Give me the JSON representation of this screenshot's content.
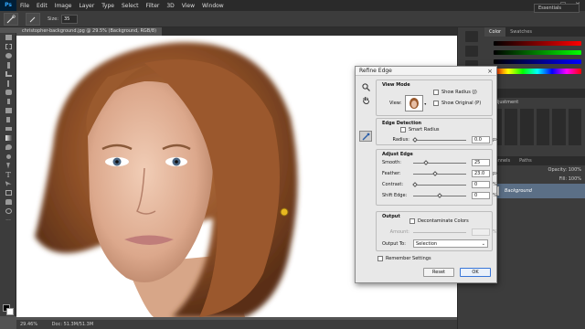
{
  "app": {
    "logo": "Ps"
  },
  "menubar": {
    "items": [
      "File",
      "Edit",
      "Image",
      "Layer",
      "Type",
      "Select",
      "Filter",
      "3D",
      "View",
      "Window"
    ]
  },
  "options": {
    "size_label": "Size:",
    "size_value": "35"
  },
  "workspace": {
    "value": "Essentials"
  },
  "document": {
    "tab_title": "christopher-background.jpg @ 29.5% (Background, RGB/8)",
    "zoom": "29.46%",
    "doc_info": "Doc: 51.3M/51.3M"
  },
  "panels": {
    "color_tabs": [
      "Color",
      "Swatches"
    ],
    "adjustments_label": "n adjustment",
    "layer_tabs": [
      "Channels",
      "Paths"
    ],
    "opacity_label": "Opacity:",
    "opacity_value": "100%",
    "fill_label": "Fill:",
    "fill_value": "100%",
    "layer_name": "Background"
  },
  "dialog": {
    "title": "Refine Edge",
    "close": "×",
    "view_mode": {
      "title": "View Mode",
      "view_label": "View:",
      "show_radius": "Show Radius (J)",
      "show_original": "Show Original (P)"
    },
    "edge_detection": {
      "title": "Edge Detection",
      "smart_radius": "Smart Radius",
      "radius_label": "Radius:",
      "radius_value": "0.0",
      "radius_unit": "px"
    },
    "adjust_edge": {
      "title": "Adjust Edge",
      "smooth_label": "Smooth:",
      "smooth_value": "25",
      "feather_label": "Feather:",
      "feather_value": "23.0",
      "feather_unit": "px",
      "contrast_label": "Contrast:",
      "contrast_value": "0",
      "contrast_unit": "%",
      "shift_label": "Shift Edge:",
      "shift_value": "0",
      "shift_unit": "%"
    },
    "output": {
      "title": "Output",
      "decontaminate": "Decontaminate Colors",
      "amount_label": "Amount:",
      "amount_unit": "%",
      "output_to_label": "Output To:",
      "output_to_value": "Selection"
    },
    "remember": "Remember Settings",
    "reset": "Reset",
    "ok": "OK"
  },
  "colors": {
    "accent": "#3875d7",
    "layer_selected": "#5b6f86",
    "hair": "#9a5a2e"
  }
}
